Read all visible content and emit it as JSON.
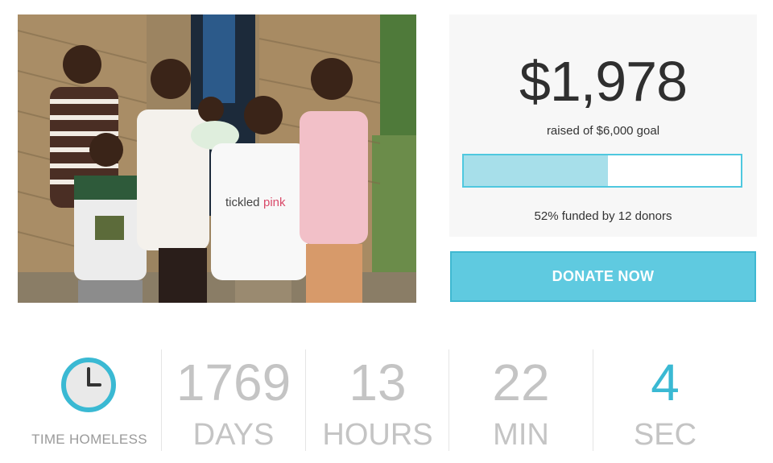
{
  "campaign": {
    "amount_raised": "$1,978",
    "goal_text": "raised of $6,000 goal",
    "funded_fraction": 0.52,
    "funded_text": "52% funded by 12 donors",
    "donate_label": "DONATE NOW"
  },
  "countdown": {
    "caption": "TIME HOMELESS",
    "icon": "clock-icon",
    "units": [
      {
        "value": "1769",
        "label": "DAYS"
      },
      {
        "value": "13",
        "label": "HOURS"
      },
      {
        "value": "22",
        "label": "MIN"
      },
      {
        "value": "4",
        "label": "SEC"
      }
    ]
  },
  "colors": {
    "accent": "#4fc8df",
    "bar_fill": "#a7dfea",
    "button": "#5fcae0",
    "muted_text": "#c4c4c4"
  }
}
